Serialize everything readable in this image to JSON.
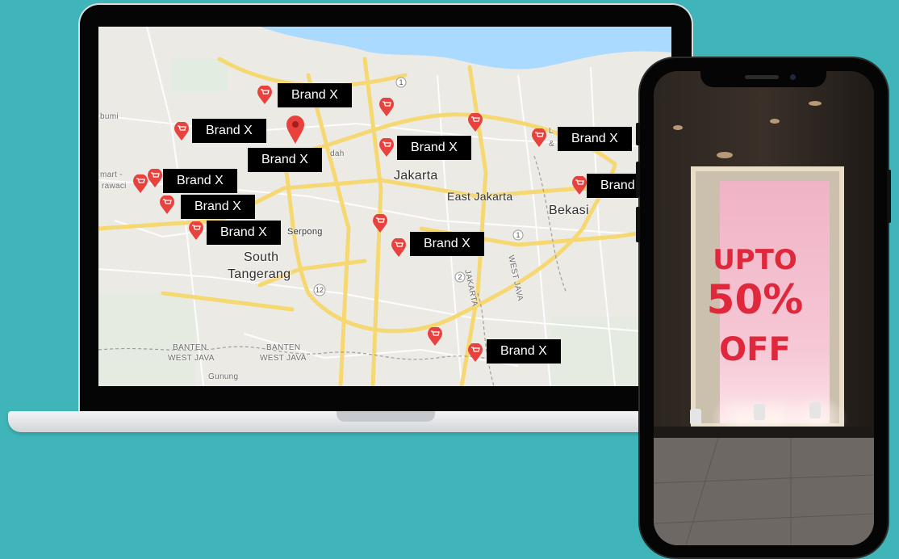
{
  "map": {
    "places": {
      "jakarta": "Jakarta",
      "east_jakarta": "East Jakarta",
      "bekasi": "Bekasi",
      "south_tangerang_1": "South",
      "south_tangerang_2": "Tangerang",
      "serpong": "Serpong",
      "banten_1": "BANTEN",
      "west_java_1": "WEST JAVA",
      "banten_2": "BANTEN",
      "west_java_2": "WEST JAVA",
      "gunung": "Gunung",
      "bumi": "bumi",
      "mart": "mart -",
      "rawaci": "rawaci",
      "dah": "dah",
      "l_amp": "L",
      "amp": "&",
      "jakarta_road": "JAKARTA",
      "west_java_road": "WEST JAVA"
    },
    "brand_labels": [
      "Brand X",
      "Brand X",
      "Brand X",
      "Brand X",
      "Brand X",
      "Brand X",
      "Brand X",
      "Brand X",
      "Brand X",
      "Brand X",
      "Brand X"
    ],
    "route_numbers": [
      "1",
      "2",
      "1",
      "12"
    ]
  },
  "phone": {
    "poster": {
      "line1": "UPTO",
      "line2": "50%",
      "line3": "OFF"
    }
  },
  "colors": {
    "background": "#3fb5b9",
    "pin": "#e8413e",
    "road_major": "#f6d873",
    "water": "#aadaff"
  },
  "icons": {
    "pin": "map-pin-icon",
    "cart": "shopping-cart-icon"
  }
}
